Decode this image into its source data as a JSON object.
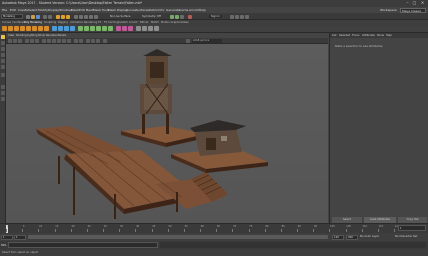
{
  "window": {
    "title": "Autodesk Maya 2017 - Student Version: C:\\Users\\User\\Desktop\\Fallen Terrain\\Fallen.mb*",
    "minimize": "–",
    "maximize": "□",
    "close": "✕"
  },
  "menubar": {
    "items": [
      "File",
      "Edit",
      "Create",
      "Select",
      "Modify",
      "Display",
      "Windows",
      "Mesh",
      "Edit Mesh",
      "Mesh Tools",
      "Mesh Display",
      "Curves",
      "Surfaces",
      "Deform",
      "UV",
      "Generate",
      "Cache",
      "Arnold",
      "Help"
    ],
    "workspace_label": "Workspace:",
    "workspace_value": "Maya Classic"
  },
  "statusline": {
    "mode": "Modeling",
    "no_live_surface": "No Live Surface",
    "symmetry": "Symmetry: Off",
    "sign_in": "Sign In"
  },
  "shelf": {
    "tabs": [
      "Curves / Surfaces",
      "Poly Modeling",
      "Sculpting",
      "Rigging",
      "Animation",
      "Rendering",
      "FX",
      "FX Caching",
      "Custom",
      "Arnold",
      "Bifrost",
      "MASH",
      "Motion Graphics",
      "XGen"
    ]
  },
  "viewport": {
    "panel_menu": [
      "View",
      "Shading",
      "Lighting",
      "Show",
      "Renderer",
      "Panels"
    ],
    "color_space": "sRGB gamma",
    "colors": {
      "background": "#5a5a5a",
      "wood_light": "#8a5a3c",
      "wood_dark": "#4a2c1c"
    }
  },
  "attribute_editor": {
    "tabs": [
      "List",
      "Selected",
      "Focus",
      "Attributes",
      "Show",
      "Help"
    ],
    "hint": "Make a selection to see attributes",
    "bottom_buttons": [
      "Select",
      "Load Attributes",
      "Copy Tab"
    ]
  },
  "timeline": {
    "ticks": [
      "1",
      "5",
      "10",
      "15",
      "20",
      "25",
      "30",
      "35",
      "40",
      "45",
      "50",
      "55",
      "60",
      "65",
      "70",
      "75",
      "80",
      "85",
      "90",
      "95",
      "100",
      "105",
      "110",
      "115",
      "120"
    ],
    "current_frame": "1"
  },
  "range": {
    "start": "1",
    "inner_start": "1",
    "inner_end": "120",
    "end": "120",
    "end2": "200",
    "anim_layer": "No Anim Layer",
    "character_set": "No Character Set"
  },
  "command_line": {
    "mel": "MEL"
  },
  "help_line": {
    "text": "Select Tool: select an object"
  }
}
